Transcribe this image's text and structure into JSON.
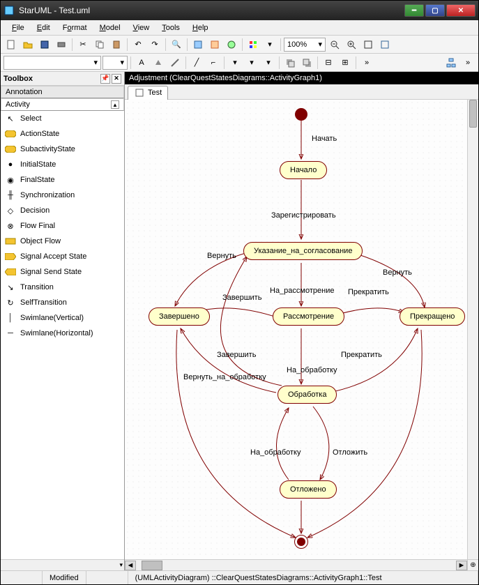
{
  "window": {
    "appTitle": "StarUML - Test.uml"
  },
  "menu": {
    "file": "File",
    "edit": "Edit",
    "format": "Format",
    "model": "Model",
    "view": "View",
    "tools": "Tools",
    "help": "Help"
  },
  "toolbar": {
    "zoom": "100%"
  },
  "toolbox": {
    "title": "Toolbox",
    "sections": {
      "annotation": "Annotation",
      "activity": "Activity"
    },
    "items": [
      {
        "label": "Select"
      },
      {
        "label": "ActionState"
      },
      {
        "label": "SubactivityState"
      },
      {
        "label": "InitialState"
      },
      {
        "label": "FinalState"
      },
      {
        "label": "Synchronization"
      },
      {
        "label": "Decision"
      },
      {
        "label": "Flow Final"
      },
      {
        "label": "Object Flow"
      },
      {
        "label": "Signal Accept State"
      },
      {
        "label": "Signal Send State"
      },
      {
        "label": "Transition"
      },
      {
        "label": "SelfTransition"
      },
      {
        "label": "Swimlane(Vertical)"
      },
      {
        "label": "Swimlane(Horizontal)"
      }
    ]
  },
  "diagram": {
    "headerPath": "Adjustment (ClearQuestStatesDiagrams::ActivityGraph1)",
    "tab": "Test",
    "nodes": {
      "start": "Начало",
      "ukaz": "Указание_на_согласование",
      "rass": "Рассмотрение",
      "zaver": "Завершено",
      "prekr": "Прекращено",
      "obrab": "Обработка",
      "otlozh": "Отложено"
    },
    "edges": {
      "begin": "Начать",
      "register": "Зарегистрировать",
      "return": "Вернуть",
      "return2": "Вернуть",
      "naRass": "На_рассмотрение",
      "prekratit": "Прекратить",
      "prekratit2": "Прекратить",
      "zavershit": "Завершить",
      "zavershit2": "Завершить",
      "naObrab": "На_обработку",
      "naObrab2": "На_обработку",
      "vernNaObrab": "Вернуть_на_обработку",
      "otlozhit": "Отложить"
    }
  },
  "status": {
    "modified": "Modified",
    "path": "(UMLActivityDiagram) ::ClearQuestStatesDiagrams::ActivityGraph1::Test"
  }
}
